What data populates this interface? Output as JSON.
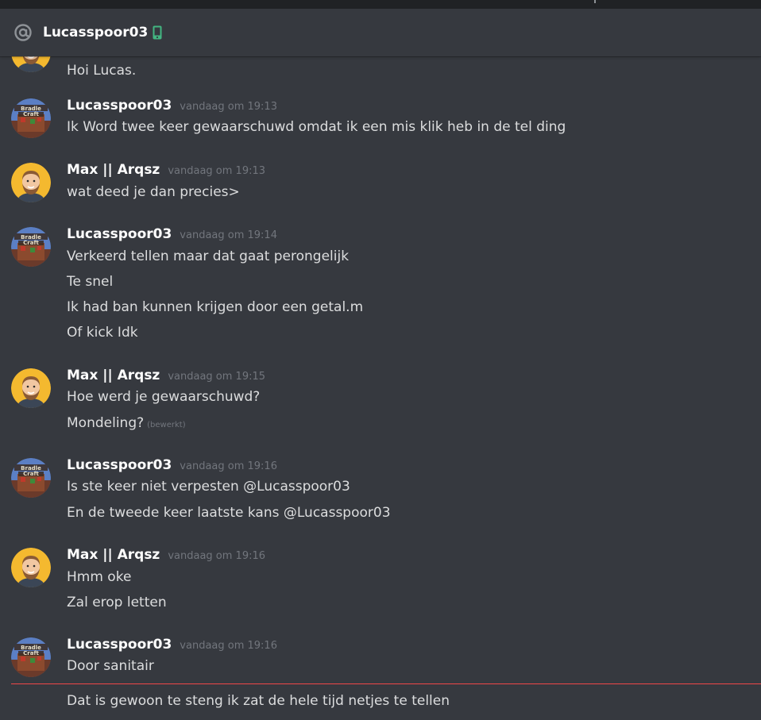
{
  "header": {
    "title": "Lucasspoor03",
    "status_icon": "mobile-phone-icon",
    "mention_icon": "at-icon"
  },
  "colors": {
    "background": "#36393f",
    "header_text": "#ffffff",
    "text": "#dcddde",
    "muted": "#72767d",
    "mobile_status": "#43b581",
    "new_divider": "#f04747"
  },
  "messages": {
    "g0": {
      "lines": [
        "Hoi Lucas."
      ]
    },
    "g1": {
      "author": "Lucasspoor03",
      "time": "vandaag om 19:13",
      "lines": [
        "Ik Word twee keer gewaarschuwd omdat ik een mis klik heb in de tel ding"
      ]
    },
    "g2": {
      "author": "Max || Arqsz",
      "time": "vandaag om 19:13",
      "lines": [
        "wat deed je dan precies>"
      ]
    },
    "g3": {
      "author": "Lucasspoor03",
      "time": "vandaag om 19:14",
      "lines": [
        "Verkeerd tellen maar dat gaat perongelijk",
        "Te snel",
        "Ik had ban kunnen krijgen door een getal.m",
        "Of kick Idk"
      ]
    },
    "g4": {
      "author": "Max || Arqsz",
      "time": "vandaag om 19:15",
      "lines": [
        "Hoe werd je gewaarschuwd?",
        "Mondeling?"
      ],
      "edited": "(bewerkt)"
    },
    "g5": {
      "author": "Lucasspoor03",
      "time": "vandaag om 19:16",
      "lines": [
        "Is ste keer niet verpesten @Lucasspoor03",
        "En de tweede keer laatste kans @Lucasspoor03"
      ]
    },
    "g6": {
      "author": "Max || Arqsz",
      "time": "vandaag om 19:16",
      "lines": [
        "Hmm oke",
        "Zal erop letten"
      ]
    },
    "g7": {
      "author": "Lucasspoor03",
      "time": "vandaag om 19:16",
      "lines": [
        "Door sanitair",
        "Dat is gewoon te steng ik zat de hele tijd netjes te tellen"
      ]
    }
  },
  "avatars": {
    "max": "bearded-man-avatar",
    "lucas": "minecraft-server-avatar"
  }
}
